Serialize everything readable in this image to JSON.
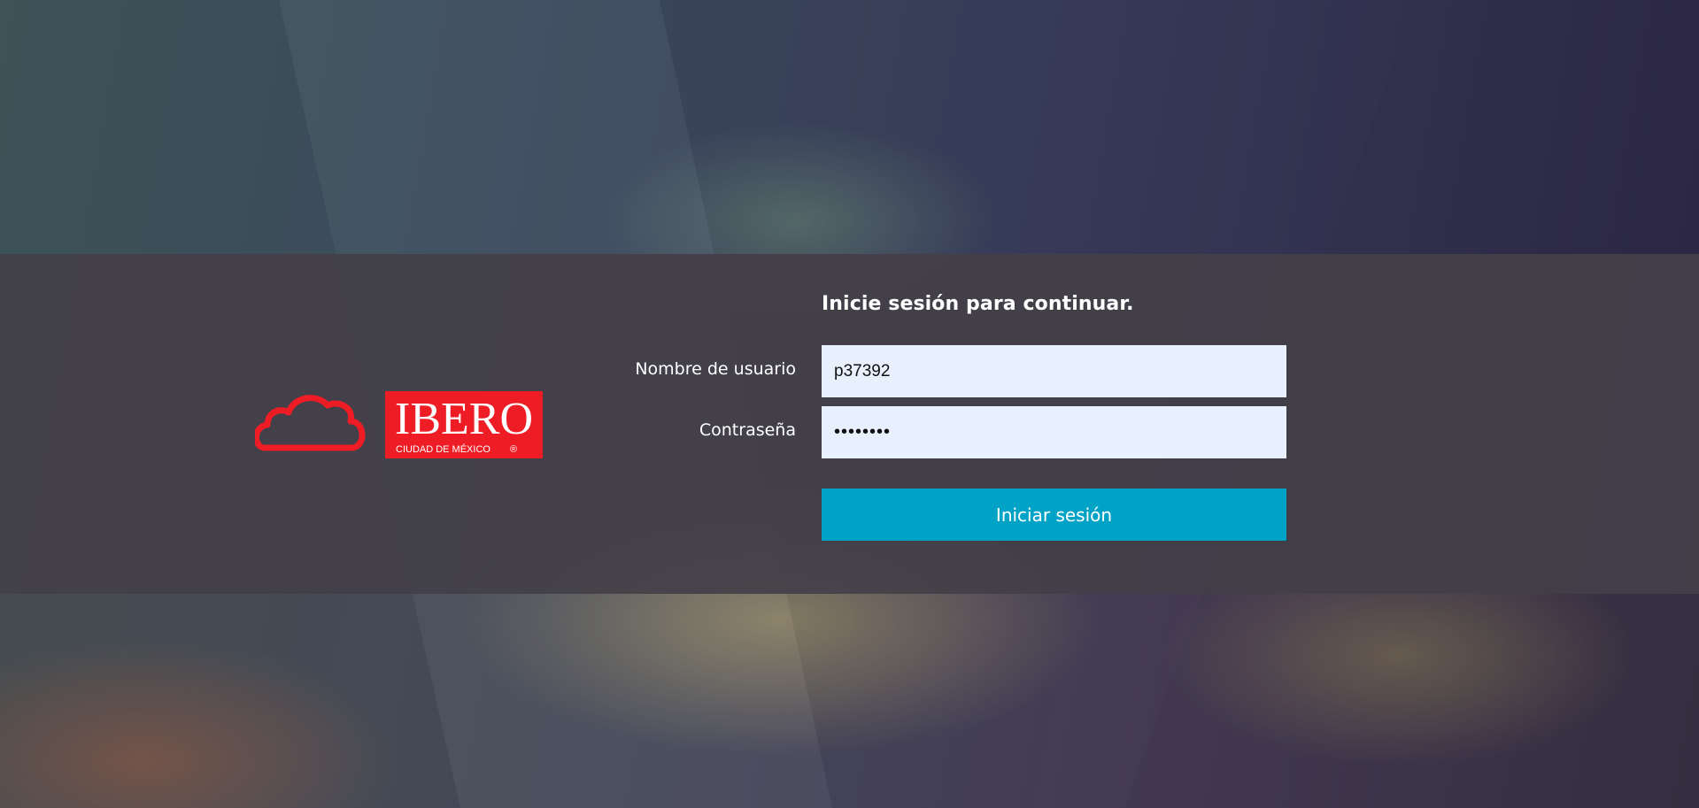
{
  "login": {
    "heading": "Inicie sesión para continuar.",
    "username_label": "Nombre de usuario",
    "username_value": "p37392",
    "password_label": "Contraseña",
    "password_value": "••••••••",
    "submit_label": "Iniciar sesión"
  },
  "logo": {
    "text_main": "IBERO",
    "text_sub": "CIUDAD DE MÉXICO",
    "registered_mark": "®",
    "icon": "cloud-icon"
  },
  "colors": {
    "band": "#444048",
    "input_bg": "#e8effd",
    "button": "#00a3c6",
    "brand_red": "#ee1c25"
  }
}
